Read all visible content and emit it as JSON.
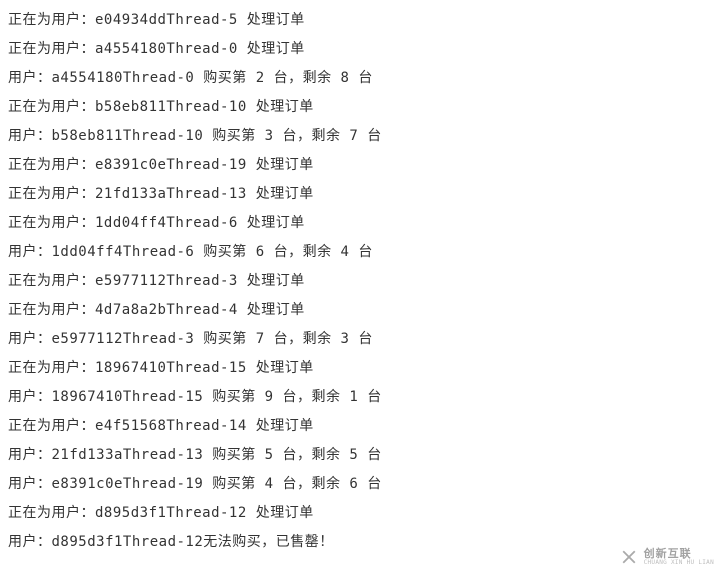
{
  "log_lines": [
    "正在为用户：e04934ddThread-5 处理订单",
    "正在为用户：a4554180Thread-0 处理订单",
    "用户：a4554180Thread-0 购买第 2 台，剩余 8 台",
    "正在为用户：b58eb811Thread-10 处理订单",
    "用户：b58eb811Thread-10 购买第 3 台，剩余 7 台",
    "正在为用户：e8391c0eThread-19 处理订单",
    "正在为用户：21fd133aThread-13 处理订单",
    "正在为用户：1dd04ff4Thread-6 处理订单",
    "用户：1dd04ff4Thread-6 购买第 6 台，剩余 4 台",
    "正在为用户：e5977112Thread-3 处理订单",
    "正在为用户：4d7a8a2bThread-4 处理订单",
    "用户：e5977112Thread-3 购买第 7 台，剩余 3 台",
    "正在为用户：18967410Thread-15 处理订单",
    "用户：18967410Thread-15 购买第 9 台，剩余 1 台",
    "正在为用户：e4f51568Thread-14 处理订单",
    "用户：21fd133aThread-13 购买第 5 台，剩余 5 台",
    "用户：e8391c0eThread-19 购买第 4 台，剩余 6 台",
    "正在为用户：d895d3f1Thread-12 处理订单",
    "用户：d895d3f1Thread-12无法购买，已售罄！"
  ],
  "watermark": {
    "cn": "创新互联",
    "en": "CHUANG XIN HU LIAN"
  }
}
